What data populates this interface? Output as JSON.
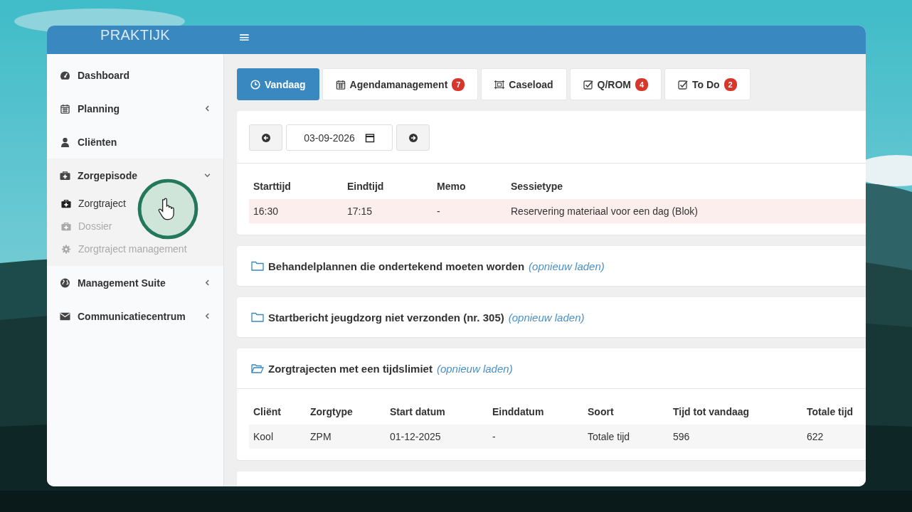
{
  "topbar": {
    "logo": "PRAKTIJK",
    "menu_glyph": "≡"
  },
  "sidebar": {
    "items": [
      {
        "label": "Dashboard",
        "kind": "link"
      },
      {
        "label": "Planning",
        "kind": "menu",
        "expanded": false
      },
      {
        "label": "Cliënten",
        "kind": "link"
      },
      {
        "label": "Zorgepisode",
        "kind": "menu",
        "expanded": true,
        "children": [
          {
            "label": "Zorgtraject",
            "selected": true
          },
          {
            "label": "Dossier",
            "selected": false
          },
          {
            "label": "Zorgtraject management",
            "selected": false
          }
        ]
      },
      {
        "label": "Management Suite",
        "kind": "menu",
        "expanded": false
      },
      {
        "label": "Communicatiecentrum",
        "kind": "menu",
        "expanded": false
      }
    ]
  },
  "tabs": [
    {
      "label": "Vandaag",
      "selected": true
    },
    {
      "label": "Agendamanagement",
      "badge": "7",
      "selected": false
    },
    {
      "label": "Caseload",
      "selected": false
    },
    {
      "label": "Q/ROM",
      "badge": "4",
      "selected": false
    },
    {
      "label": "To Do",
      "badge": "2",
      "selected": false
    }
  ],
  "today": {
    "date": "03-09-2026",
    "columns": [
      "Starttijd",
      "Eindtijd",
      "Memo",
      "Sessietype"
    ],
    "rows": [
      [
        "16:30",
        "17:15",
        "-",
        "Reservering materiaal voor een dag (Blok)"
      ]
    ]
  },
  "panels": [
    {
      "title": "Behandelplannen die ondertekend moeten worden",
      "reload": "(opnieuw laden)",
      "expanded": false
    },
    {
      "title": "Startbericht jeugdzorg niet verzonden (nr. 305)",
      "reload": "(opnieuw laden)",
      "expanded": false
    },
    {
      "title": "Zorgtrajecten met een tijdslimiet",
      "reload": "(opnieuw laden)",
      "expanded": true,
      "columns": [
        "Cliënt",
        "Zorgtype",
        "Start datum",
        "Einddatum",
        "Soort",
        "Tijd tot vandaag",
        "Totale tijd"
      ],
      "rows": [
        [
          "Kool",
          "ZPM",
          "01-12-2025",
          "-",
          "Totale tijd",
          "596",
          "622"
        ]
      ]
    }
  ]
}
